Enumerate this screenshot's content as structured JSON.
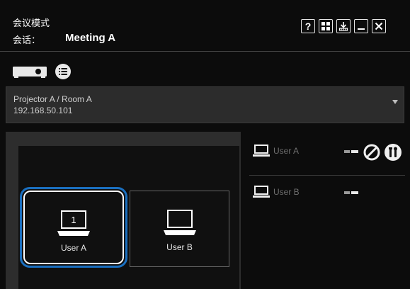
{
  "titlebar": {
    "mode_label": "会议模式",
    "session_label": "会话：",
    "meeting_name": "Meeting A",
    "buttons": [
      "help-icon",
      "grid-icon",
      "download-icon",
      "minimize-icon",
      "close-icon"
    ]
  },
  "devices": {
    "projector_tab_icon": "projector-icon",
    "list_icon": "list-icon"
  },
  "projector": {
    "name": "Projector A / Room A",
    "ip": "192.168.50.101"
  },
  "layout": {
    "tiles": [
      {
        "label": "User A",
        "number": "1",
        "selected": true
      },
      {
        "label": "User B",
        "number": "",
        "selected": false
      }
    ]
  },
  "users": [
    {
      "name": "User A",
      "icons": [
        "laptop-icon",
        "status-bars-icon",
        "block-icon",
        "tools-icon"
      ]
    },
    {
      "name": "User B",
      "icons": [
        "laptop-icon",
        "status-bars-icon"
      ]
    }
  ],
  "colors": {
    "accent": "#1a6fbf",
    "background": "#0c0c0c",
    "panel": "#2c2c2c",
    "muted_text": "#6f6f6f"
  }
}
